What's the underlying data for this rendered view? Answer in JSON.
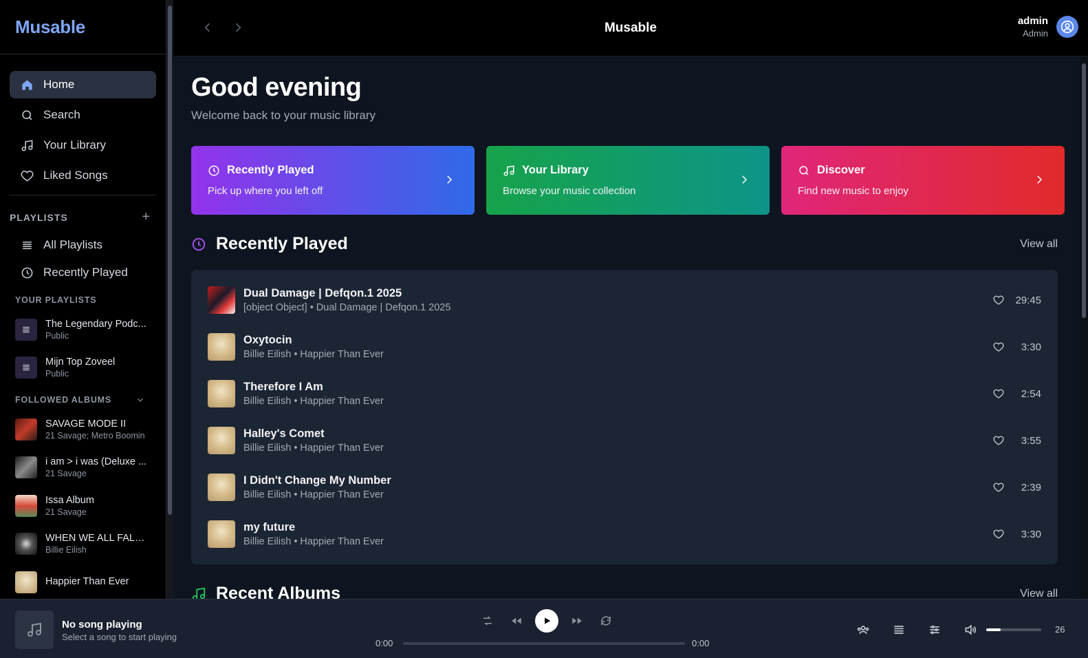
{
  "app": {
    "logo": "Musable"
  },
  "sidebar": {
    "nav": [
      {
        "label": "Home",
        "icon": "home-icon",
        "active": true
      },
      {
        "label": "Search",
        "icon": "search-icon"
      },
      {
        "label": "Your Library",
        "icon": "music-note-icon"
      },
      {
        "label": "Liked Songs",
        "icon": "heart-icon"
      }
    ],
    "playlists_header": "PLAYLISTS",
    "playlists_add": "+",
    "playlist_links": [
      {
        "label": "All Playlists",
        "icon": "list-icon"
      },
      {
        "label": "Recently Played",
        "icon": "clock-icon"
      }
    ],
    "your_playlists_label": "YOUR PLAYLISTS",
    "your_playlists": [
      {
        "name": "The Legendary Podc...",
        "visibility": "Public"
      },
      {
        "name": "Mijn Top Zoveel",
        "visibility": "Public"
      }
    ],
    "followed_albums_label": "FOLLOWED ALBUMS",
    "followed_albums": [
      {
        "name": "SAVAGE MODE II",
        "artist": "21 Savage; Metro Boomin",
        "color": "#8b2a1f"
      },
      {
        "name": "i am > i was (Deluxe ...",
        "artist": "21 Savage",
        "color": "#3a3a3a"
      },
      {
        "name": "Issa Album",
        "artist": "21 Savage",
        "color": "#d84a3a"
      },
      {
        "name": "WHEN WE ALL FALL ...",
        "artist": "Billie Eilish",
        "color": "#2a2a2a"
      },
      {
        "name": "Happier Than Ever",
        "artist": "",
        "color": "#d8bf90"
      }
    ]
  },
  "topbar": {
    "title": "Musable",
    "user_name": "admin",
    "user_role": "Admin"
  },
  "main": {
    "greeting": "Good evening",
    "welcome": "Welcome back to your music library",
    "cards": [
      {
        "title": "Recently Played",
        "subtitle": "Pick up where you left off",
        "icon": "clock-icon"
      },
      {
        "title": "Your Library",
        "subtitle": "Browse your music collection",
        "icon": "music-note-icon"
      },
      {
        "title": "Discover",
        "subtitle": "Find new music to enjoy",
        "icon": "search-icon"
      }
    ],
    "recently_played_title": "Recently Played",
    "view_all": "View all",
    "tracks": [
      {
        "title": "Dual Damage | Defqon.1 2025",
        "subtitle": "[object Object] • Dual Damage | Defqon.1 2025",
        "duration": "29:45"
      },
      {
        "title": "Oxytocin",
        "subtitle": "Billie Eilish • Happier Than Ever",
        "duration": "3:30"
      },
      {
        "title": "Therefore I Am",
        "subtitle": "Billie Eilish • Happier Than Ever",
        "duration": "2:54"
      },
      {
        "title": "Halley's Comet",
        "subtitle": "Billie Eilish • Happier Than Ever",
        "duration": "3:55"
      },
      {
        "title": "I Didn't Change My Number",
        "subtitle": "Billie Eilish • Happier Than Ever",
        "duration": "2:39"
      },
      {
        "title": "my future",
        "subtitle": "Billie Eilish • Happier Than Ever",
        "duration": "3:30"
      }
    ],
    "recent_albums_title": "Recent Albums",
    "recent_albums_view_all": "View all"
  },
  "player": {
    "title": "No song playing",
    "subtitle": "Select a song to start playing",
    "current_time": "0:00",
    "total_time": "0:00",
    "volume": "26",
    "volume_fraction": 0.26
  }
}
